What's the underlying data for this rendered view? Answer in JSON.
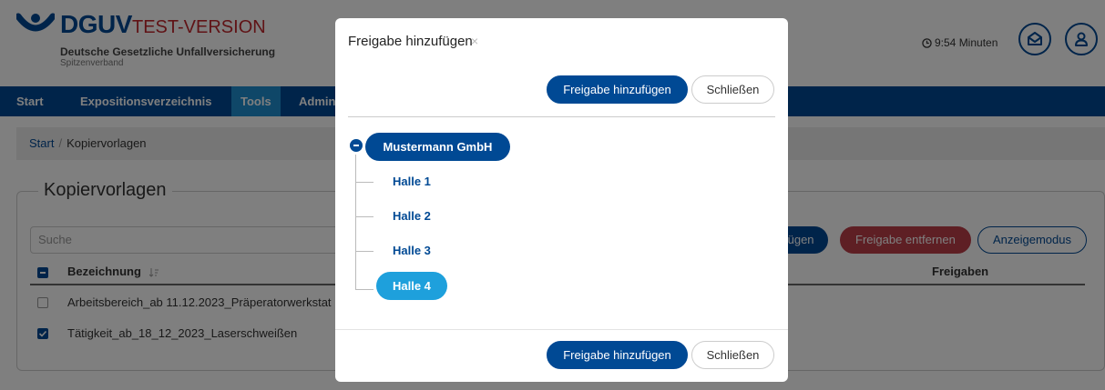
{
  "header": {
    "brand": "DGUV",
    "test_label": "TEST-VERSION",
    "subtitle": "Deutsche Gesetzliche Unfallversicherung",
    "subtitle2": "Spitzenverband",
    "timer": "9:54 Minuten"
  },
  "nav": [
    "Start",
    "Expositionsverzeichnis",
    "Tools",
    "Admin"
  ],
  "breadcrumb": {
    "home": "Start",
    "separator": "/",
    "current": "Kopiervorlagen"
  },
  "main": {
    "title": "Kopiervorlagen",
    "search_placeholder": "Suche",
    "buttons": {
      "add_partial": "fügen",
      "remove": "Freigabe entfernen",
      "display_mode": "Anzeigemodus"
    },
    "columns": {
      "name": "Bezeichnung",
      "shares": "Freigaben"
    },
    "rows": [
      {
        "name": "Arbeitsbereich_ab 11.12.2023_Präperatorwerkstat",
        "checked": false
      },
      {
        "name": "Tätigkeit_ab_18_12_2023_Laserschweißen",
        "checked": true
      }
    ]
  },
  "modal": {
    "title": "Freigabe hinzufügen",
    "close_symbol": "×",
    "primary_label": "Freigabe hinzufügen",
    "secondary_label": "Schließen",
    "tree": {
      "root": "Mustermann GmbH",
      "children": [
        "Halle 1",
        "Halle 2",
        "Halle 3",
        "Halle 4"
      ],
      "selected": "Halle 4"
    }
  },
  "colors": {
    "primary": "#004994",
    "accent": "#1ea0dc",
    "danger": "#b52a35",
    "brand_red": "#c0272d"
  },
  "icons": [
    "clock-icon",
    "mail-icon",
    "user-icon",
    "sort-icon",
    "collapse-icon"
  ]
}
